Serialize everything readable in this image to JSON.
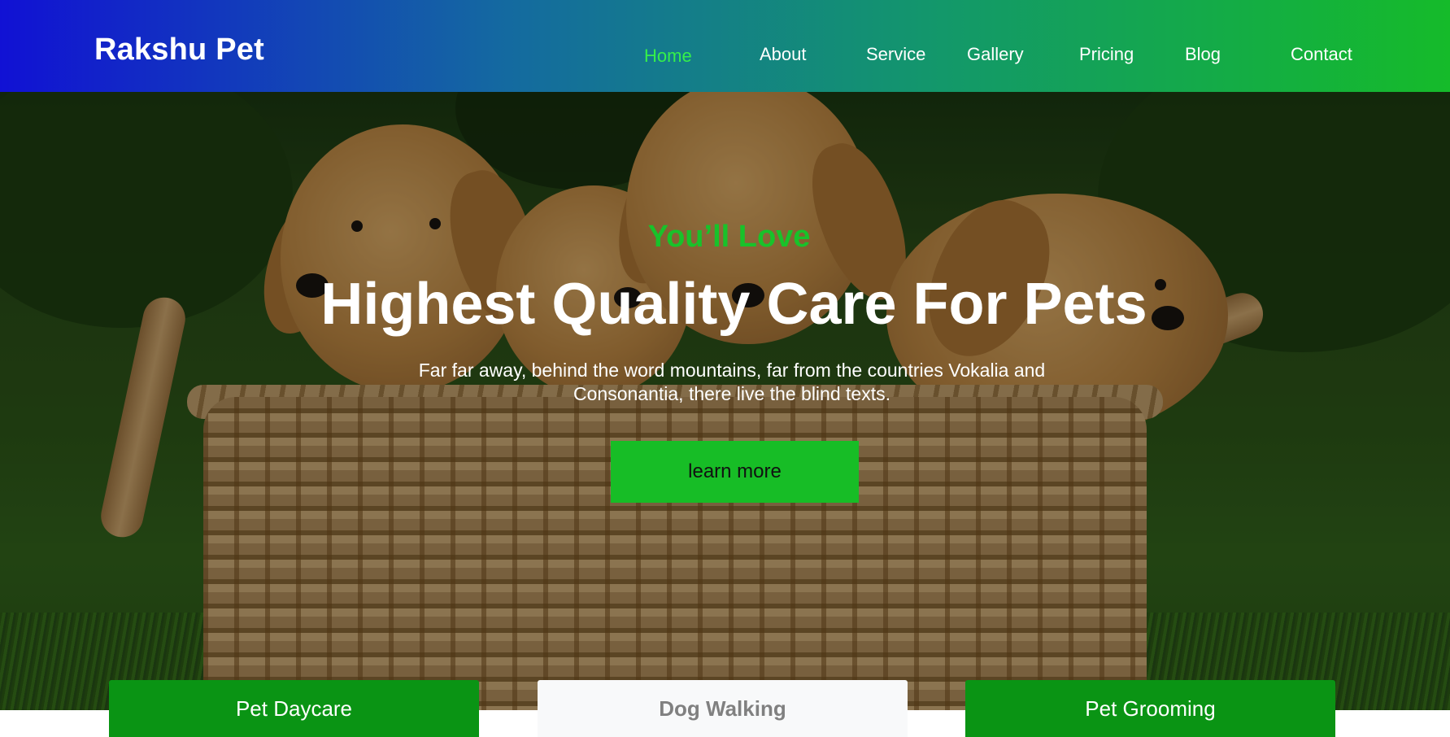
{
  "brand": "Rakshu Pet",
  "nav": {
    "items": [
      {
        "label": "Home",
        "active": true
      },
      {
        "label": "About",
        "active": false
      },
      {
        "label": "Service",
        "active": false
      },
      {
        "label": "Gallery",
        "active": false
      },
      {
        "label": "Pricing",
        "active": false
      },
      {
        "label": "Blog",
        "active": false
      },
      {
        "label": "Contact",
        "active": false
      }
    ]
  },
  "hero": {
    "eyebrow": "You’ll Love",
    "headline": "Highest Quality Care For Pets",
    "subtext": "Far far away, behind the word mountains, far from the countries Vokalia and Consonantia, there live the blind texts.",
    "cta_label": "learn more"
  },
  "cards": [
    {
      "label": "Pet Daycare",
      "style": "green"
    },
    {
      "label": "Dog Walking",
      "style": "light"
    },
    {
      "label": "Pet Grooming",
      "style": "green"
    }
  ],
  "colors": {
    "accent_green": "#17bd26",
    "nav_gradient_start": "#1111d4",
    "nav_gradient_end": "#15bb2a",
    "active_nav": "#35f04a"
  }
}
